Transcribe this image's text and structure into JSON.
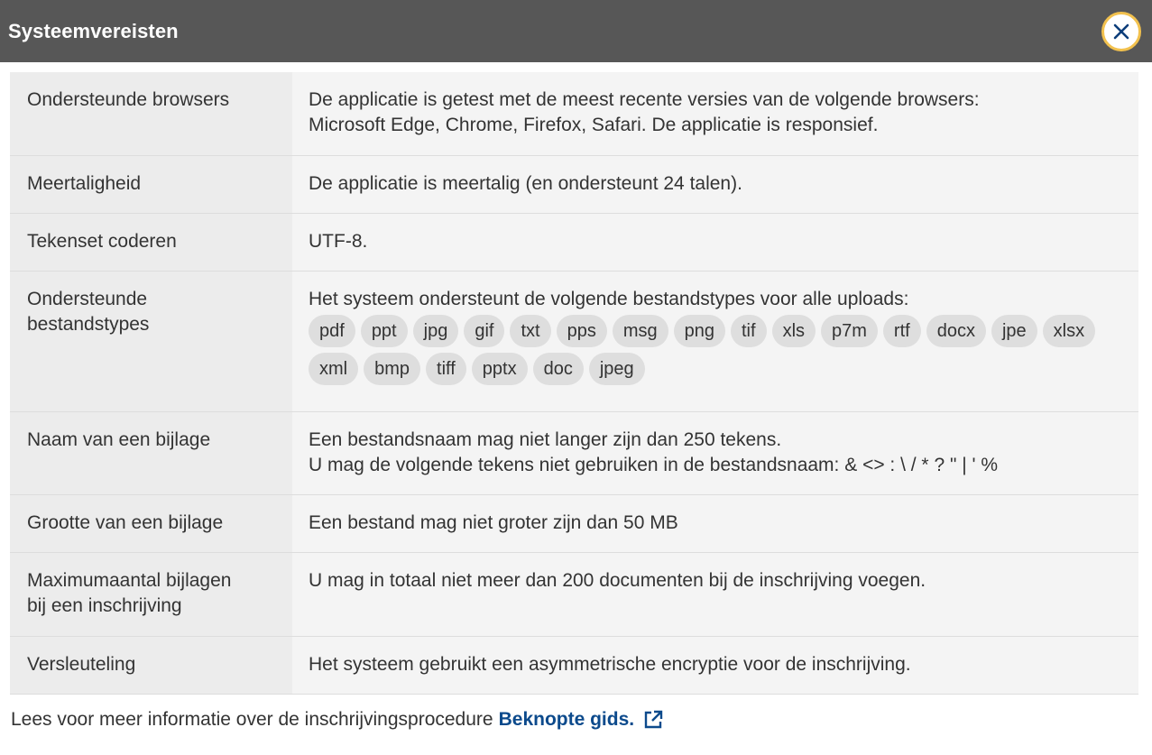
{
  "dialog": {
    "title": "Systeemvereisten",
    "close_icon": "close-icon"
  },
  "rows": {
    "browsers": {
      "label": "Ondersteunde browsers",
      "line1": "De applicatie is getest met de meest recente versies van de volgende browsers:",
      "line2": "Microsoft Edge, Chrome, Firefox, Safari. De applicatie is responsief."
    },
    "language": {
      "label": "Meertaligheid",
      "value": "De applicatie is meertalig (en ondersteunt 24 talen)."
    },
    "charset": {
      "label": "Tekenset coderen",
      "value": "UTF-8."
    },
    "filetypes": {
      "label_line1": "Ondersteunde",
      "label_line2": "bestandstypes",
      "value": "Het systeem ondersteunt de volgende bestandstypes voor alle uploads:",
      "chips": [
        "pdf",
        "ppt",
        "jpg",
        "gif",
        "txt",
        "pps",
        "msg",
        "png",
        "tif",
        "xls",
        "p7m",
        "rtf",
        "docx",
        "jpe",
        "xlsx",
        "xml",
        "bmp",
        "tiff",
        "pptx",
        "doc",
        "jpeg"
      ]
    },
    "attachment_name": {
      "label": "Naam van een bijlage",
      "line1": "Een bestandsnaam mag niet langer zijn dan 250 tekens.",
      "line2": "U mag de volgende tekens niet gebruiken in de bestandsnaam: & <> : \\ / * ? \" | ' %"
    },
    "attachment_size": {
      "label": "Grootte van een bijlage",
      "value": "Een bestand mag niet groter zijn dan 50 MB"
    },
    "max_attachments": {
      "label_line1": "Maximumaantal bijlagen",
      "label_line2": "bij een inschrijving",
      "value": "U mag in totaal niet meer dan 200 documenten bij de inschrijving voegen."
    },
    "encryption": {
      "label": "Versleuteling",
      "value": "Het systeem gebruikt een asymmetrische encryptie voor de inschrijving."
    }
  },
  "footer": {
    "text": "Lees voor meer informatie over de inschrijvingsprocedure",
    "link": "Beknopte gids.",
    "link_icon": "external-link-icon"
  },
  "colors": {
    "header_bg": "#575757",
    "close_border": "#f2c14e",
    "close_x": "#0c3d7a",
    "link": "#0c4a8c"
  }
}
